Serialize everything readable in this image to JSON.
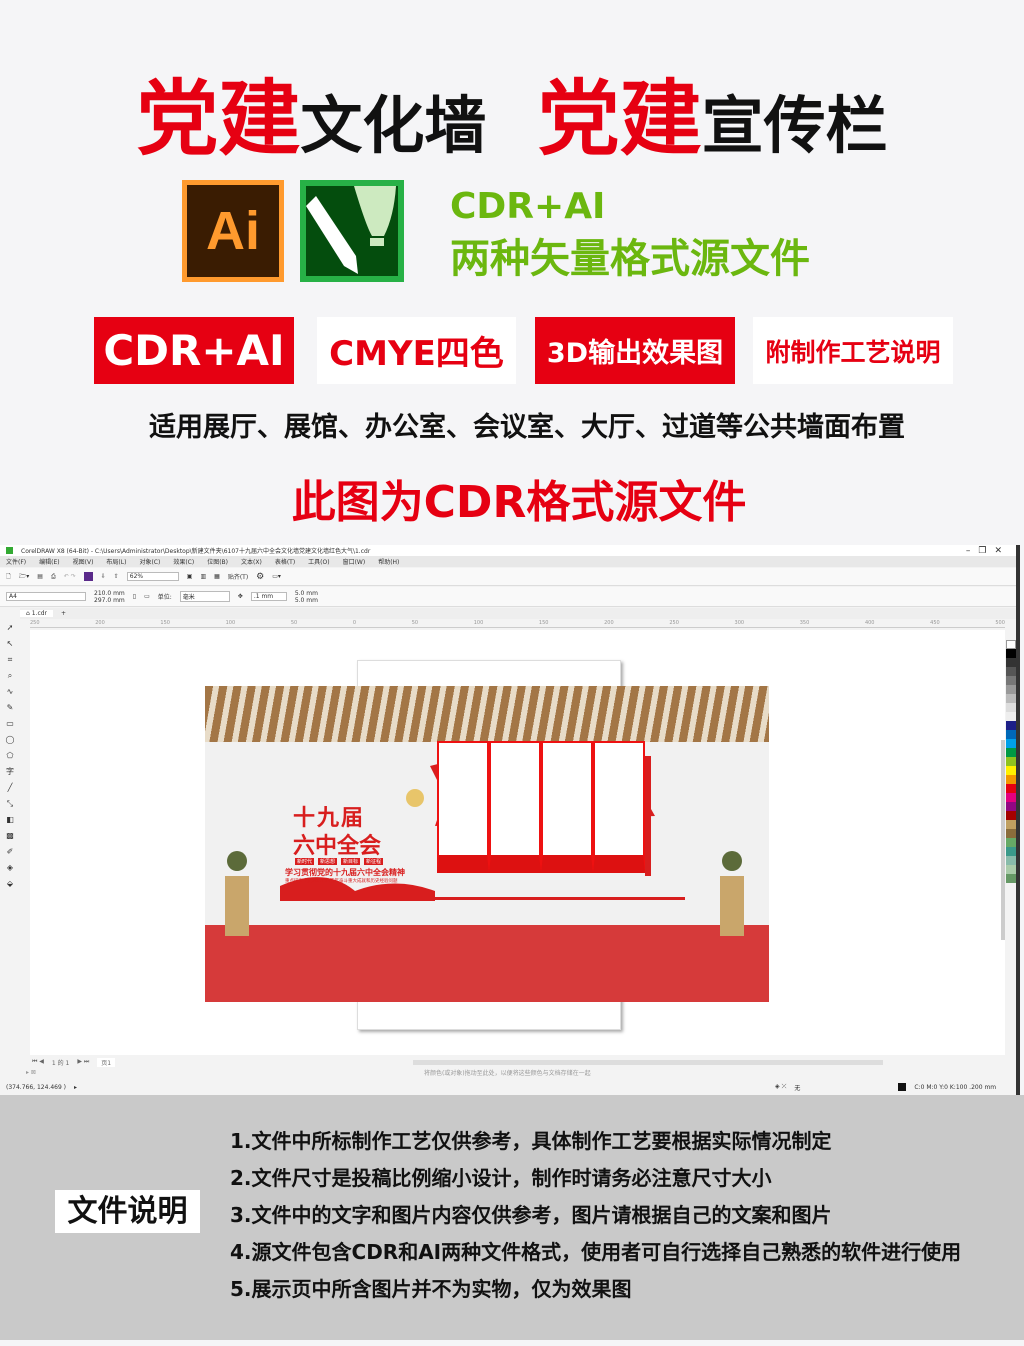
{
  "header": {
    "title_a_red": "党建",
    "title_a_black": "文化墙",
    "title_b_red": "党建",
    "title_b_black": "宣传栏"
  },
  "logos": {
    "ai": "Ai",
    "cdr": "corel-balloon-pen-icon"
  },
  "formats": {
    "line1": "CDR+AI",
    "line2": "两种矢量格式源文件"
  },
  "badges": [
    {
      "label": "CDR+AI",
      "style": "red"
    },
    {
      "label": "CMYE四色",
      "style": "white"
    },
    {
      "label": "3D输出效果图",
      "style": "red"
    },
    {
      "label": "附制作工艺说明",
      "style": "white"
    }
  ],
  "usage": "适用展厅、展馆、办公室、会议室、大厅、过道等公共墙面布置",
  "source_note": "此图为CDR格式源文件",
  "colors": {
    "red": "#e60012",
    "green": "#6bb70f",
    "carpet": "#d63a3a"
  },
  "app": {
    "title": "CorelDRAW X8 (64-Bit) - C:\\Users\\Administrator\\Desktop\\新建文件夹\\6107十九届六中全会文化墙党建文化墙红色大气\\1.cdr",
    "menu": [
      "文件(F)",
      "编辑(E)",
      "视图(V)",
      "布局(L)",
      "对象(C)",
      "效果(C)",
      "位图(B)",
      "文本(X)",
      "表格(T)",
      "工具(O)",
      "窗口(W)",
      "帮助(H)"
    ],
    "zoom": "62%",
    "snap": "贴齐(T)",
    "page_size": "A4",
    "width": "210.0 mm",
    "height": "297.0 mm",
    "unit_label": "单位:",
    "unit": "毫米",
    "nudge": ".1 mm",
    "dup_x": "5.0 mm",
    "dup_y": "5.0 mm",
    "tab": "1.cdr",
    "ruler": [
      "250",
      "200",
      "150",
      "100",
      "50",
      "0",
      "50",
      "100",
      "150",
      "200",
      "250",
      "300",
      "350",
      "400",
      "450",
      "500"
    ],
    "page_nav": "1 的 1",
    "page_tab": "页1",
    "hint": "将颜色(或对象)拖动至此处，以便将这些颜色与文档存储在一起",
    "coords": "(374.766, 124.469 )",
    "fill_none": "无",
    "outline": "C:0 M:0 Y:0 K:100  .200 mm"
  },
  "artwork": {
    "headline1": "十九届",
    "headline2": "六中全会",
    "tags": [
      "新时代",
      "新思想",
      "新目标",
      "新征程"
    ],
    "subtitle": "学习贯彻党的十九届六中全会精神",
    "subline": "重点研究全面总结党的百年奋斗重大成就和历史经验问题"
  },
  "notes": {
    "label": "文件说明",
    "items": [
      "1.文件中所标制作工艺仅供参考，具体制作工艺要根据实际情况制定",
      "2.文件尺寸是投稿比例缩小设计，制作时请务必注意尺寸大小",
      "3.文件中的文字和图片内容仅供参考，图片请根据自己的文案和图片",
      "4.源文件包含CDR和AI两种文件格式，使用者可自行选择自己熟悉的软件进行使用",
      "5.展示页中所含图片并不为实物，仅为效果图"
    ]
  }
}
